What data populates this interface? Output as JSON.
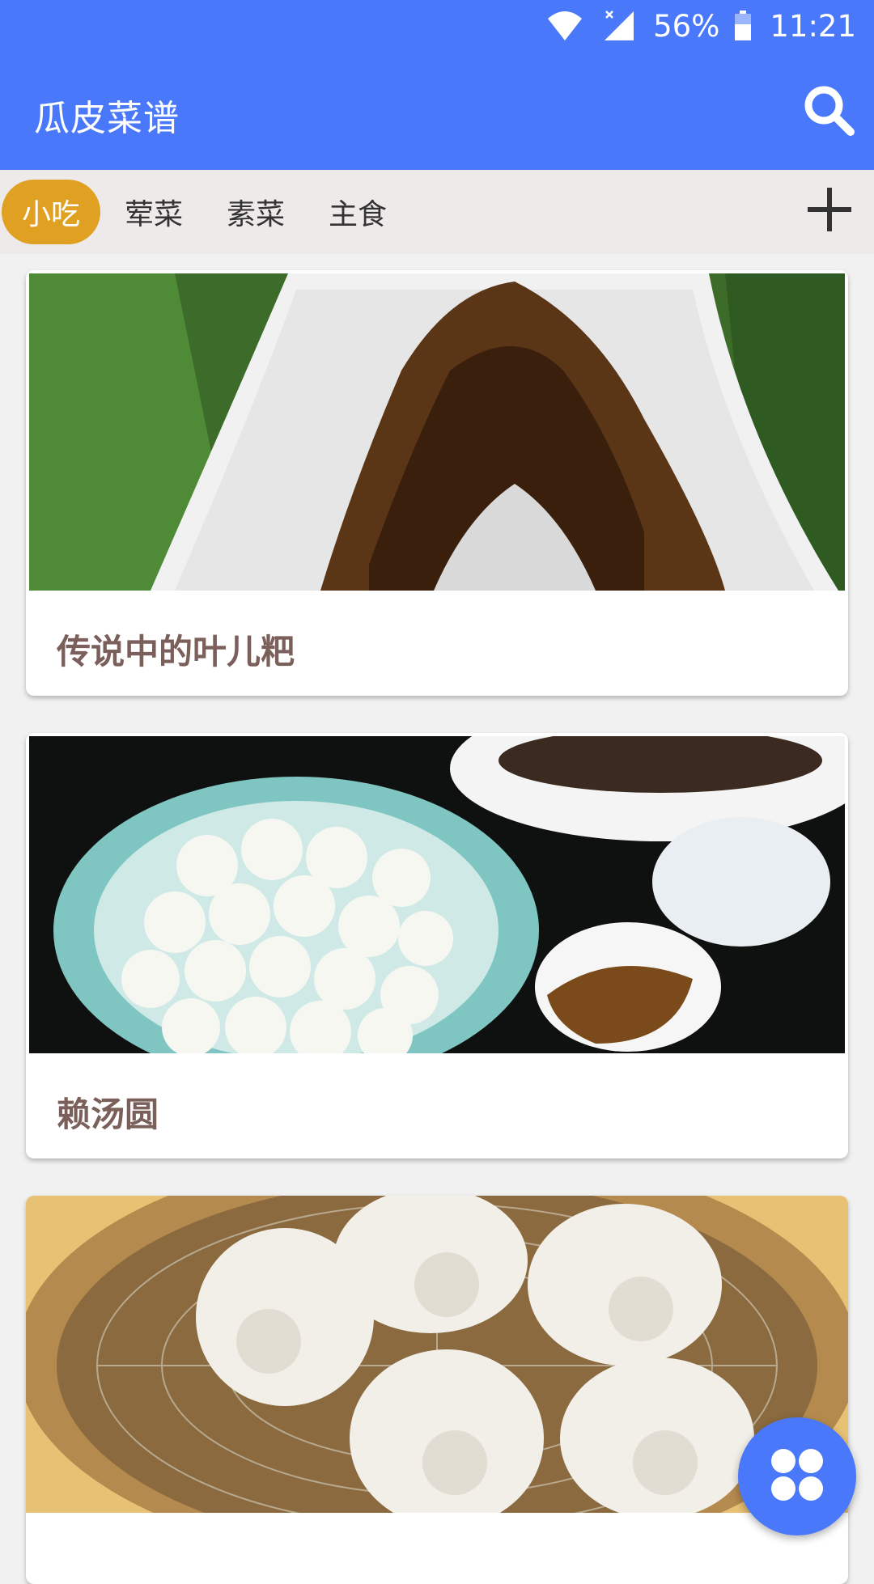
{
  "status_bar": {
    "battery_percent": "56%",
    "time": "11:21",
    "icons": [
      "wifi-icon",
      "signal-icon",
      "battery-icon"
    ]
  },
  "app_bar": {
    "title": "瓜皮菜谱",
    "search_icon": "search-icon"
  },
  "tabs": {
    "items": [
      {
        "label": "小吃",
        "active": true
      },
      {
        "label": "荤菜",
        "active": false
      },
      {
        "label": "素菜",
        "active": false
      },
      {
        "label": "主食",
        "active": false
      }
    ],
    "add_icon": "plus-icon"
  },
  "cards": [
    {
      "title": "传说中的叶儿粑",
      "image": "food-photo"
    },
    {
      "title": "赖汤圆",
      "image": "food-photo"
    },
    {
      "title": "",
      "image": "food-photo"
    }
  ],
  "fab": {
    "icon": "clover-icon"
  },
  "colors": {
    "primary": "#4a78fa",
    "tab_active": "#e0a021",
    "card_title": "#7a5f5a"
  }
}
